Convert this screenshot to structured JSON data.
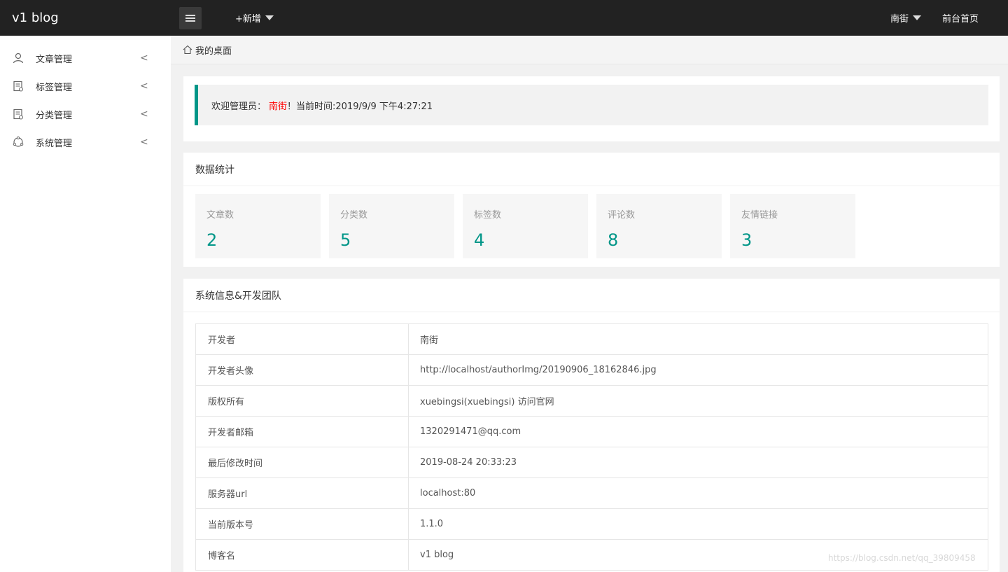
{
  "app": {
    "title": "v1 blog"
  },
  "topbar": {
    "add_label": "+新增",
    "user_name": "南街",
    "front_link": "前台首页"
  },
  "sidebar": {
    "items": [
      {
        "label": "文章管理",
        "icon": "user-icon"
      },
      {
        "label": "标签管理",
        "icon": "document-icon"
      },
      {
        "label": "分类管理",
        "icon": "document-icon"
      },
      {
        "label": "系统管理",
        "icon": "system-icon"
      }
    ],
    "arrow": "<"
  },
  "breadcrumb": {
    "label": "我的桌面"
  },
  "welcome": {
    "prefix": "欢迎管理员：",
    "name": "南街",
    "suffix": "！当前时间:2019/9/9 下午4:27:21"
  },
  "stats": {
    "title": "数据统计",
    "items": [
      {
        "label": "文章数",
        "value": "2"
      },
      {
        "label": "分类数",
        "value": "5"
      },
      {
        "label": "标签数",
        "value": "4"
      },
      {
        "label": "评论数",
        "value": "8"
      },
      {
        "label": "友情链接",
        "value": "3"
      }
    ]
  },
  "info": {
    "title": "系统信息&开发团队",
    "rows": [
      {
        "key": "开发者",
        "value": "南街"
      },
      {
        "key": "开发者头像",
        "value": "http://localhost/authorImg/20190906_18162846.jpg"
      },
      {
        "key": "版权所有",
        "value": "xuebingsi(xuebingsi) 访问官网"
      },
      {
        "key": "开发者邮箱",
        "value": "1320291471@qq.com"
      },
      {
        "key": "最后修改时间",
        "value": "2019-08-24 20:33:23"
      },
      {
        "key": "服务器url",
        "value": "localhost:80"
      },
      {
        "key": "当前版本号",
        "value": "1.1.0"
      },
      {
        "key": "博客名",
        "value": "v1 blog"
      }
    ]
  },
  "watermark": "https://blog.csdn.net/qq_39809458",
  "colors": {
    "accent": "#009688",
    "topbar": "#222222",
    "highlight": "#ff0000"
  }
}
